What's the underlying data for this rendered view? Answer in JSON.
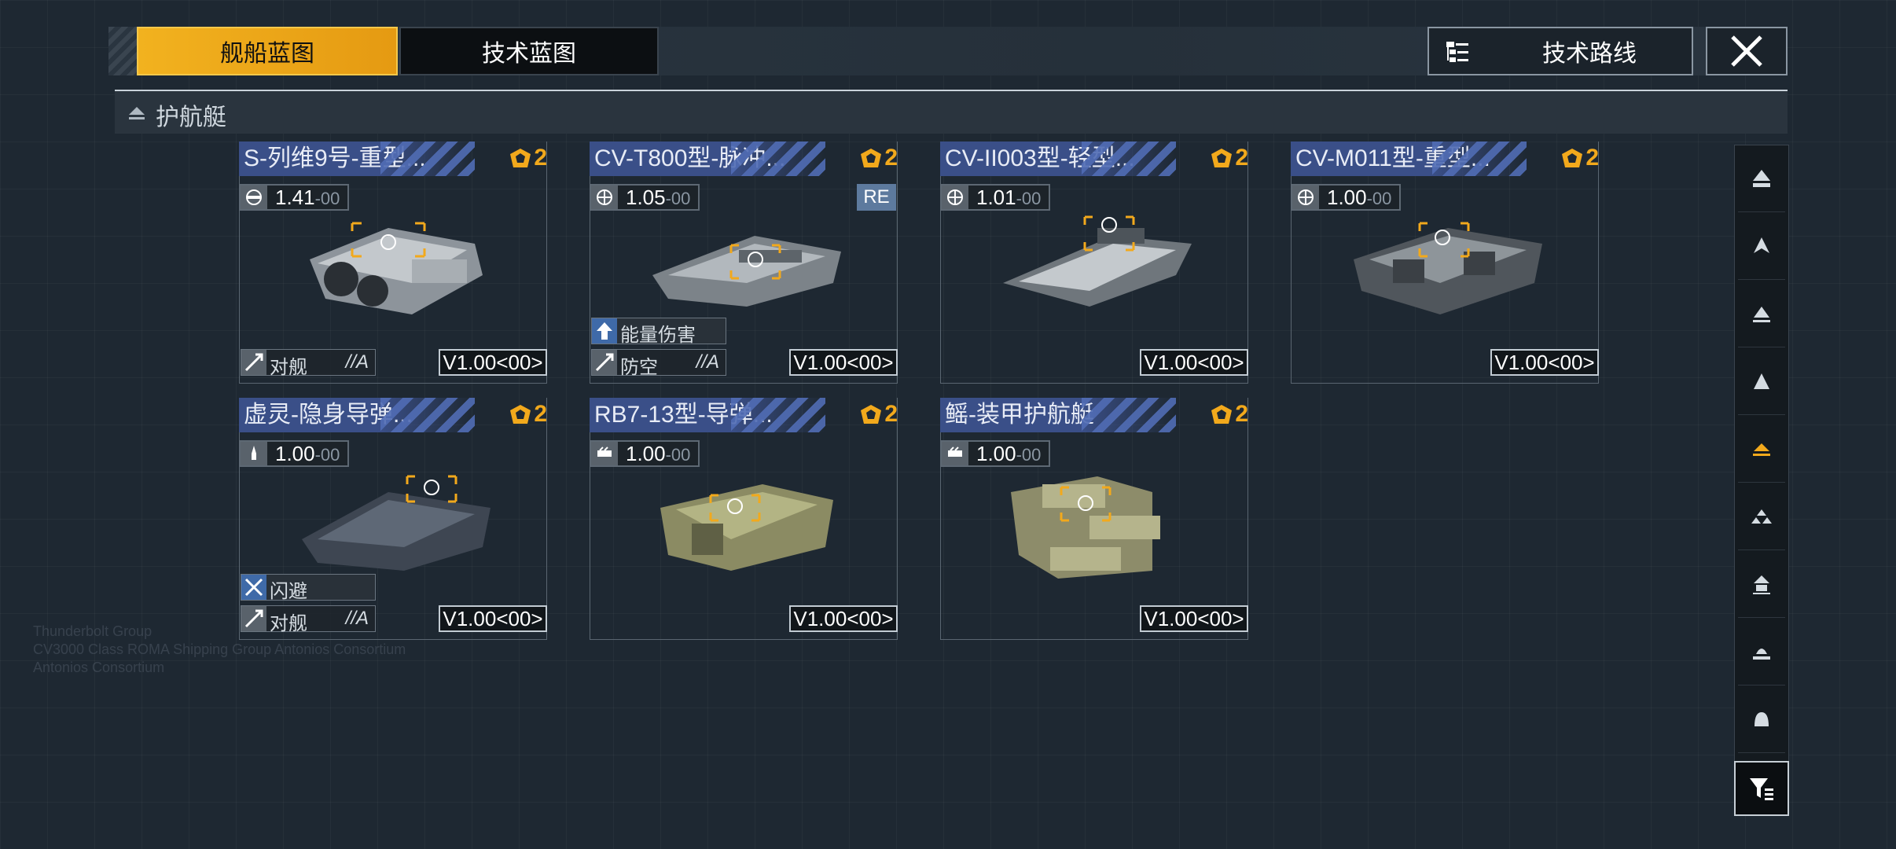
{
  "tabs": {
    "active": "舰船蓝图",
    "inactive": "技术蓝图"
  },
  "tech_route_label": "技术路线",
  "category": "护航艇",
  "background_text": [
    "Thunderbolt Group",
    "CV3000 Class ROMA Shipping Group Antonios Consortium",
    "Antonios Consortium"
  ],
  "colors": {
    "accent": "#f2b21f",
    "title_bg": "#3a4f88",
    "background": "#1e2832"
  },
  "cards": [
    {
      "name": "S-列维9号-重型...",
      "rank": "2",
      "power": "1.41",
      "power_suffix": "-00",
      "version": "V1.00<00>",
      "trait": "对舰",
      "trait_grade": "//A",
      "power_icon": "cannon-icon"
    },
    {
      "name": "CV-T800型-脉冲...",
      "rank": "2",
      "power": "1.05",
      "power_suffix": "-00",
      "version": "V1.00<00>",
      "trait": "防空",
      "trait_grade": "//A",
      "badge": "能量伤害",
      "tag": "RE",
      "power_icon": "globe-icon"
    },
    {
      "name": "CV-II003型-轻型...",
      "rank": "2",
      "power": "1.01",
      "power_suffix": "-00",
      "version": "V1.00<00>",
      "power_icon": "globe-icon"
    },
    {
      "name": "CV-M011型-重型...",
      "rank": "2",
      "power": "1.00",
      "power_suffix": "-00",
      "version": "V1.00<00>",
      "power_icon": "globe-icon"
    },
    {
      "name": "虚灵-隐身导弹...",
      "rank": "2",
      "power": "1.00",
      "power_suffix": "-00",
      "version": "V1.00<00>",
      "trait": "对舰",
      "trait_grade": "//A",
      "badge": "闪避",
      "power_icon": "missile-icon"
    },
    {
      "name": "RB7-13型-导弹...",
      "rank": "2",
      "power": "1.00",
      "power_suffix": "-00",
      "version": "V1.00<00>",
      "power_icon": "missile-pod-icon"
    },
    {
      "name": "鳐-装甲护航艇",
      "rank": "2",
      "power": "1.00",
      "power_suffix": "-00",
      "version": "V1.00<00>",
      "power_icon": "missile-pod-icon"
    }
  ],
  "sidebar_icons": [
    "carrier-icon",
    "destroyer-icon",
    "frigate-icon",
    "corvette-icon",
    "escort-icon",
    "fighter-icon",
    "station-icon",
    "cruiser-icon",
    "battleship-icon"
  ],
  "filter_icon": "filter-icon"
}
